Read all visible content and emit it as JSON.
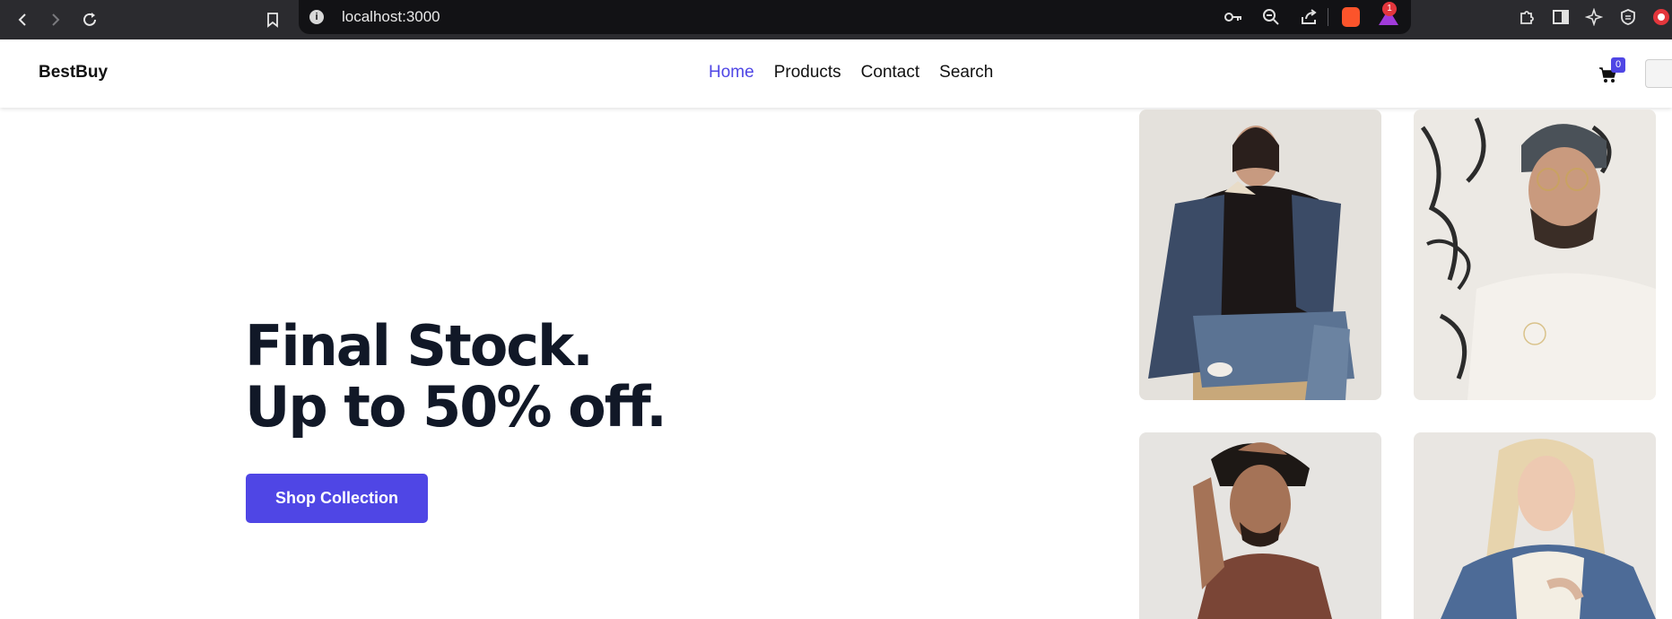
{
  "browser": {
    "url": "localhost:3000",
    "info_icon": "i",
    "rewards_badge": "1",
    "icons": [
      "back-icon",
      "forward-icon",
      "reload-icon",
      "bookmark-icon",
      "key-icon",
      "zoom-out-icon",
      "share-icon",
      "brave-shields-icon",
      "brave-rewards-icon",
      "extensions-icon",
      "sidebar-icon",
      "leo-icon",
      "vpn-icon",
      "profile-icon"
    ]
  },
  "header": {
    "logo": "BestBuy",
    "nav": {
      "home": "Home",
      "products": "Products",
      "contact": "Contact",
      "search": "Search"
    },
    "cart_count": "0",
    "accent_color": "#4f46e5"
  },
  "hero": {
    "line1": "Final Stock.",
    "line2": "Up to 50% off.",
    "cta": "Shop Collection"
  },
  "products": [
    {
      "name": "woman-denim-jacket-photo"
    },
    {
      "name": "man-beanie-white-tee-photo"
    },
    {
      "name": "man-brown-tee-photo"
    },
    {
      "name": "woman-blonde-denim-photo"
    }
  ]
}
